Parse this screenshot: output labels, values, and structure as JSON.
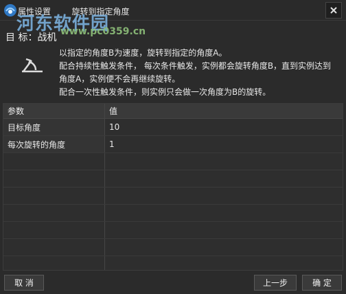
{
  "window": {
    "title": "属性设置        旋转到指定角度",
    "close_icon": "close-icon"
  },
  "watermark": {
    "name": "河东软件园",
    "url": "www.pc0359.cn"
  },
  "target_label": "目  标：战机",
  "description": [
    "以指定的角度B为速度，旋转到指定的角度A。",
    "配合持续性触发条件， 每次条件触发，实例都会旋转角度B，直到实例达到",
    "角度A，实例便不会再继续旋转。",
    "配合一次性触发条件，则实例只会做一次角度为B的旋转。"
  ],
  "table": {
    "headers": [
      "参数",
      "值"
    ],
    "rows": [
      {
        "param": "目标角度",
        "value": "10"
      },
      {
        "param": "每次旋转的角度",
        "value": "1"
      }
    ]
  },
  "buttons": {
    "cancel": "取 消",
    "prev": "上一步",
    "ok": "确 定"
  },
  "colors": {
    "background": "#2b2b2b",
    "header": "#3a3a3a",
    "watermark": "#7fb7e6"
  }
}
